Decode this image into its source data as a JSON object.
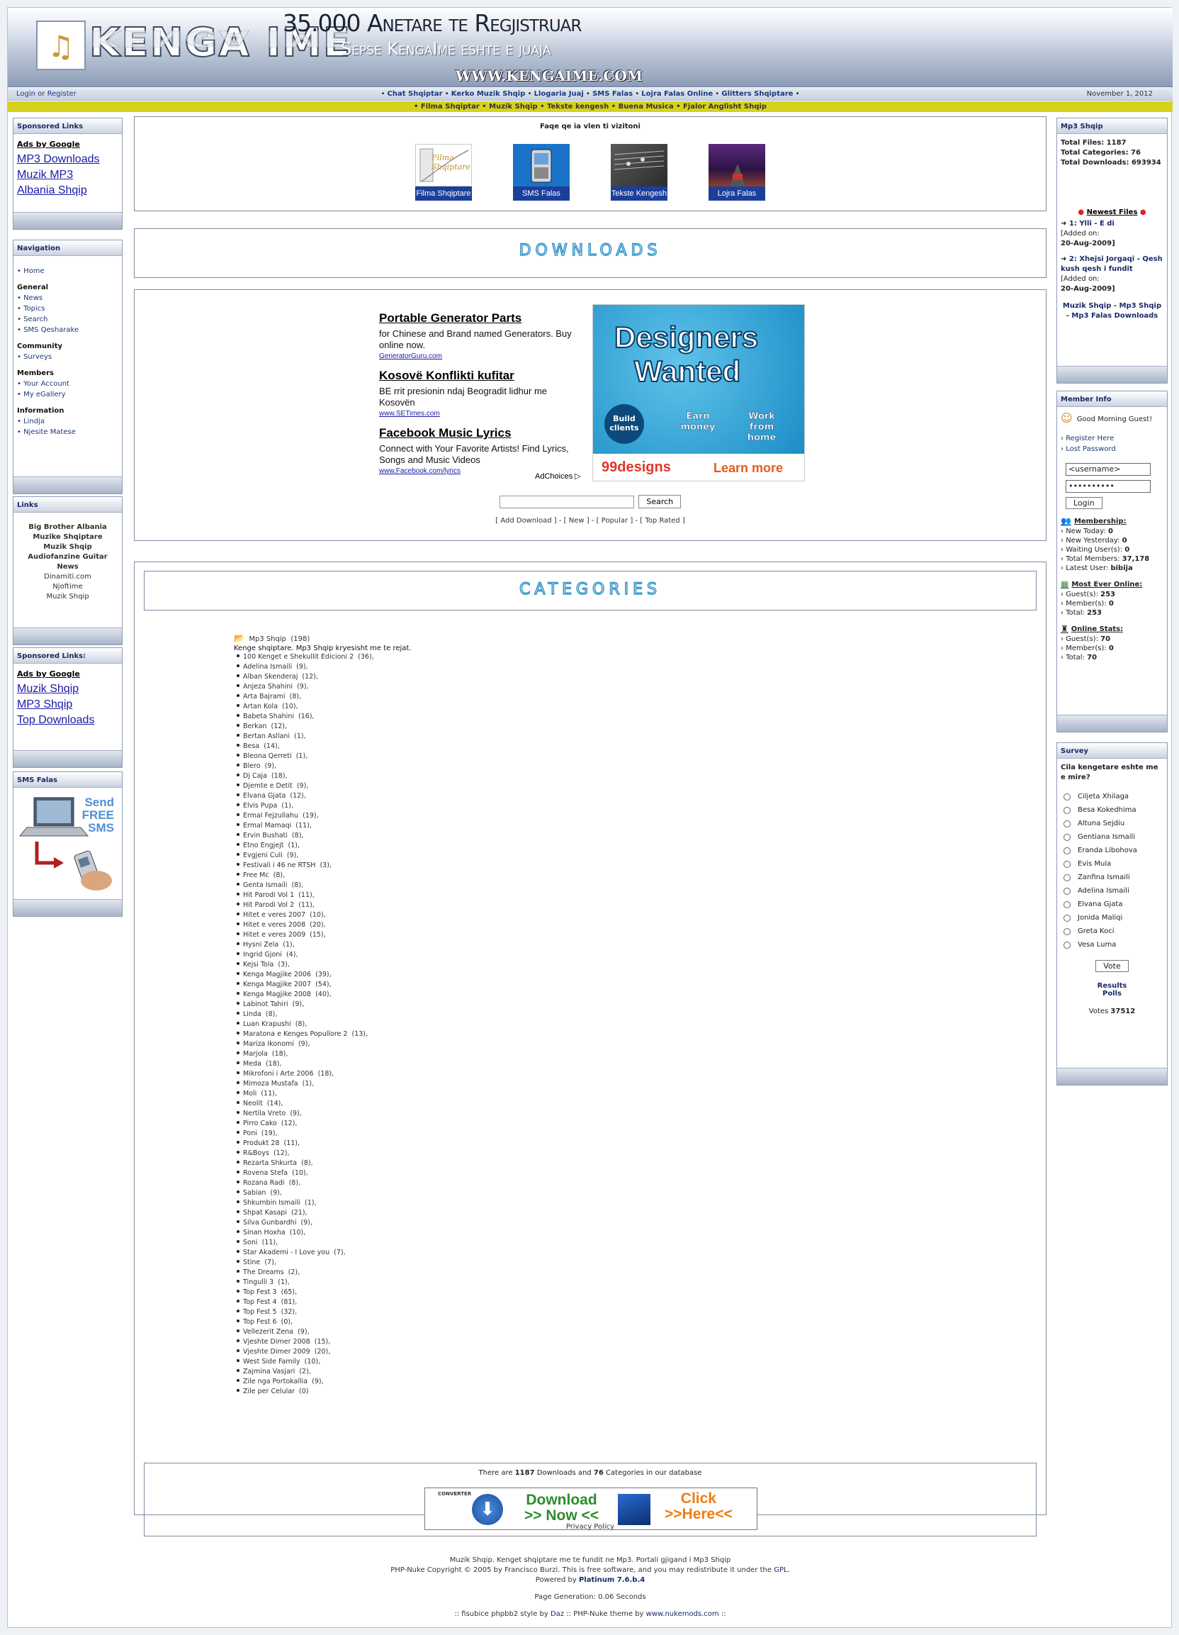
{
  "header": {
    "logo_text": "KENGA IME",
    "members_banner": "35.000 Anetare te Regjistruar",
    "slogan": "Sepse KengaIme eshte e juaja",
    "site_url": "WWW.KENGAIME.COM"
  },
  "topbar": {
    "login": "Login",
    "or": "or",
    "register": "Register",
    "links": [
      "Chat Shqiptar",
      "Kerko Muzik Shqip",
      "Llogaria Juaj",
      "SMS Falas",
      "Lojra Falas Online",
      "Glitters Shqiptare"
    ],
    "links2": [
      "Filma Shqiptar",
      "Muzik Shqip",
      "Tekste kengesh",
      "Buena Musica",
      "Fjalor Anglisht Shqip"
    ],
    "date": "November 1, 2012"
  },
  "left": {
    "sponsored1": {
      "title": "Sponsored Links",
      "ads_by": "Ads by Google",
      "links": [
        "MP3 Downloads",
        "Muzik MP3",
        "Albania Shqip"
      ]
    },
    "navigation": {
      "title": "Navigation",
      "home": "Home",
      "sections": [
        {
          "name": "General",
          "items": [
            "News",
            "Topics",
            "Search",
            "SMS Qesharake"
          ]
        },
        {
          "name": "Community",
          "items": [
            "Surveys"
          ]
        },
        {
          "name": "Members",
          "items": [
            "Your Account",
            "My eGallery"
          ]
        },
        {
          "name": "Information",
          "items": [
            "Lindja",
            "Njesite Matese"
          ]
        }
      ]
    },
    "links_block": {
      "title": "Links",
      "bold": [
        "Big Brother Albania",
        "Muzike Shqiptare",
        "Muzik Shqip",
        "Audiofanzine Guitar News"
      ],
      "normal": [
        "Dinamiti.com",
        "Njoftime",
        "Muzik Shqip"
      ]
    },
    "sponsored2": {
      "title": "Sponsored Links:",
      "ads_by": "Ads by Google",
      "links": [
        "Muzik Shqip",
        "MP3 Shqip",
        "Top Downloads"
      ]
    },
    "sms": {
      "title": "SMS Falas",
      "ad_line1": "Send",
      "ad_line2": "FREE",
      "ad_line3": "SMS"
    }
  },
  "center": {
    "visit": {
      "title": "Faqe qe ia vlen ti vizitoni",
      "items": [
        "Filma Shqiptare",
        "SMS Falas",
        "Tekste Kengesh",
        "Lojra Falas"
      ],
      "filma_logo": "Filma Shqiptare"
    },
    "downloads_banner": "DOWNLOADS",
    "ads": [
      {
        "title": "Portable Generator Parts",
        "desc": "for Chinese and Brand named Generators. Buy online now.",
        "url": "GeneratorGuru.com"
      },
      {
        "title": "Kosovë Konflikti kufitar",
        "desc": "BE rrit presionin ndaj Beogradit lidhur me Kosovën",
        "url": "www.SETimes.com"
      },
      {
        "title": "Facebook Music Lyrics",
        "desc": "Connect with Your Favorite Artists! Find Lyrics, Songs and Music Videos",
        "url": "www.Facebook.com/lyrics"
      }
    ],
    "adchoices": "AdChoices",
    "designers_ad": {
      "line1": "Designers",
      "line2": "Wanted",
      "b1": "Build clients",
      "b2": "Earn money",
      "b3": "Work from home",
      "brand": "99designs",
      "cta": "Learn more"
    },
    "search_button": "Search",
    "dl_links": [
      "Add Download",
      "New",
      "Popular",
      "Top Rated"
    ],
    "categories_banner": "CATEGORIES",
    "cat_main": {
      "name": "Mp3 Shqip",
      "count": "(198)",
      "desc": "Kenge shqiptare. Mp3 Shqip kryesisht me te rejat."
    },
    "categories": [
      [
        "100 Kenget e Shekullit Edicioni 2",
        "(36)"
      ],
      [
        "Adelina Ismaili",
        "(9)"
      ],
      [
        "Alban Skenderaj",
        "(12)"
      ],
      [
        "Anjeza Shahini",
        "(9)"
      ],
      [
        "Arta Bajrami",
        "(8)"
      ],
      [
        "Artan Kola",
        "(10)"
      ],
      [
        "Babeta Shahini",
        "(16)"
      ],
      [
        "Berkan",
        "(12)"
      ],
      [
        "Bertan Asllani",
        "(1)"
      ],
      [
        "Besa",
        "(14)"
      ],
      [
        "Bleona Qerreti",
        "(1)"
      ],
      [
        "Blero",
        "(9)"
      ],
      [
        "Dj Caja",
        "(18)"
      ],
      [
        "Djemte e Detit",
        "(9)"
      ],
      [
        "Elvana Gjata",
        "(12)"
      ],
      [
        "Elvis Pupa",
        "(1)"
      ],
      [
        "Ermal Fejzullahu",
        "(19)"
      ],
      [
        "Ermal Mamaqi",
        "(11)"
      ],
      [
        "Ervin Bushati",
        "(8)"
      ],
      [
        "Etno Engjejt",
        "(1)"
      ],
      [
        "Evgjeni Culi",
        "(9)"
      ],
      [
        "Festivali i 46 ne RTSH",
        "(3)"
      ],
      [
        "Free Mc",
        "(8)"
      ],
      [
        "Genta Ismaili",
        "(8)"
      ],
      [
        "Hit Parodi Vol 1",
        "(11)"
      ],
      [
        "Hit Parodi Vol 2",
        "(11)"
      ],
      [
        "Hitet e veres 2007",
        "(10)"
      ],
      [
        "Hitet e veres 2008",
        "(20)"
      ],
      [
        "Hitet e veres 2009",
        "(15)"
      ],
      [
        "Hysni Zela",
        "(1)"
      ],
      [
        "Ingrid Gjoni",
        "(4)"
      ],
      [
        "Kejsi Tola",
        "(3)"
      ],
      [
        "Kenga Magjike 2006",
        "(39)"
      ],
      [
        "Kenga Magjike 2007",
        "(54)"
      ],
      [
        "Kenga Magjike 2008",
        "(40)"
      ],
      [
        "Labinot Tahiri",
        "(9)"
      ],
      [
        "Linda",
        "(8)"
      ],
      [
        "Luan Krapushi",
        "(8)"
      ],
      [
        "Maratona e Kenges Popullore 2",
        "(13)"
      ],
      [
        "Mariza Ikonomi",
        "(9)"
      ],
      [
        "Marjola",
        "(18)"
      ],
      [
        "Meda",
        "(18)"
      ],
      [
        "Mikrofoni i Arte 2006",
        "(18)"
      ],
      [
        "Mimoza Mustafa",
        "(1)"
      ],
      [
        "Moli",
        "(11)"
      ],
      [
        "Neolit",
        "(14)"
      ],
      [
        "Nertila Vreto",
        "(9)"
      ],
      [
        "Pirro Cako",
        "(12)"
      ],
      [
        "Poni",
        "(19)"
      ],
      [
        "Produkt 28",
        "(11)"
      ],
      [
        "R&Boys",
        "(12)"
      ],
      [
        "Rezarta Shkurta",
        "(8)"
      ],
      [
        "Rovena Stefa",
        "(10)"
      ],
      [
        "Rozana Radi",
        "(8)"
      ],
      [
        "Sabian",
        "(9)"
      ],
      [
        "Shkumbin Ismaili",
        "(1)"
      ],
      [
        "Shpat Kasapi",
        "(21)"
      ],
      [
        "Silva Gunbardhi",
        "(9)"
      ],
      [
        "Sinan Hoxha",
        "(10)"
      ],
      [
        "Soni",
        "(11)"
      ],
      [
        "Star Akademi - I Love you",
        "(7)"
      ],
      [
        "Stine",
        "(7)"
      ],
      [
        "The Dreams",
        "(2)"
      ],
      [
        "Tingulli 3",
        "(1)"
      ],
      [
        "Top Fest 3",
        "(65)"
      ],
      [
        "Top Fest 4",
        "(81)"
      ],
      [
        "Top Fest 5",
        "(32)"
      ],
      [
        "Top Fest 6",
        "(0)"
      ],
      [
        "Vellezerit Zena",
        "(9)"
      ],
      [
        "Vjeshte Dimer 2008",
        "(15)"
      ],
      [
        "Vjeshte Dimer 2009",
        "(20)"
      ],
      [
        "West Side Family",
        "(10)"
      ],
      [
        "Zajmina Vasjari",
        "(2)"
      ],
      [
        "Zile nga Portokallia",
        "(9)"
      ],
      [
        "Zile per Celular",
        "(0)"
      ]
    ],
    "stats": {
      "pre": "There are",
      "downloads": "1187",
      "mid": "Downloads and",
      "categories": "76",
      "post": "Categories in our database"
    },
    "convert_ad": {
      "brand": "CONVERTER",
      "dl1": "Download",
      "dl2": ">> Now <<",
      "c1": "Click",
      "c2": ">>Here<<"
    }
  },
  "right": {
    "mp3": {
      "title": "Mp3 Shqip",
      "total_files": "Total Files: 1187",
      "total_cats": "Total Categories: 76",
      "total_dl": "Total Downloads: 693934",
      "newest": "Newest Files",
      "files": [
        {
          "n": "1: Ylli - E di",
          "added": "[Added on:",
          "date": "20-Aug-2009]"
        },
        {
          "n": "2: Xhejsi Jorgaqi - Qesh kush qesh i fundit",
          "added": "[Added on:",
          "date": "20-Aug-2009]"
        }
      ],
      "footer": "Muzik Shqip - Mp3 Shqip - Mp3 Falas Downloads"
    },
    "member": {
      "title": "Member Info",
      "greeting": "Good Morning Guest!",
      "register": "Register Here",
      "lost": "Lost Password",
      "username": "<username>",
      "password": "••••••••••",
      "login": "Login",
      "membership": "Membership:",
      "m_lines": [
        [
          "New Today:",
          "0"
        ],
        [
          "New Yesterday:",
          "0"
        ],
        [
          "Waiting User(s):",
          "0"
        ],
        [
          "Total Members:",
          "37,178"
        ],
        [
          "Latest User:",
          "bibija"
        ]
      ],
      "most": "Most Ever Online:",
      "most_lines": [
        [
          "Guest(s):",
          "253"
        ],
        [
          "Member(s):",
          "0"
        ],
        [
          "Total:",
          "253"
        ]
      ],
      "online": "Online Stats:",
      "online_lines": [
        [
          "Guest(s):",
          "70"
        ],
        [
          "Member(s):",
          "0"
        ],
        [
          "Total:",
          "70"
        ]
      ]
    },
    "survey": {
      "title": "Survey",
      "question": "Cila kengetare eshte me e mire?",
      "options": [
        "Ciljeta Xhilaga",
        "Besa Kokedhima",
        "Altuna Sejdiu",
        "Gentiana Ismaili",
        "Eranda Libohova",
        "Evis Mula",
        "Zanfina Ismaili",
        "Adelina Ismaili",
        "Elvana Gjata",
        "Jonida Maliqi",
        "Greta Koci",
        "Vesa Luma"
      ],
      "vote": "Vote",
      "results": "Results",
      "polls": "Polls",
      "votes_label": "Votes",
      "votes": "37512"
    }
  },
  "footer": {
    "privacy": "Privacy Policy",
    "line1": "Muzik Shqip. Kenget shqiptare me te fundit ne Mp3. Portali gjigand i Mp3 Shqip",
    "line2a": "PHP-Nuke Copyright © 2005 by Francisco Burzi. This is free software, and you may redistribute it under the",
    "line2b": "GPL",
    "powered": "Powered by",
    "platinum": "Platinum 7.6.b.4",
    "generation": "Page Generation: 0.06 Seconds",
    "credits_a": ":: fisubice phpbb2 style by",
    "credits_b": "Daz",
    "credits_c": ":: PHP-Nuke theme by",
    "credits_d": "www.nukemods.com",
    "credits_e": "::"
  }
}
